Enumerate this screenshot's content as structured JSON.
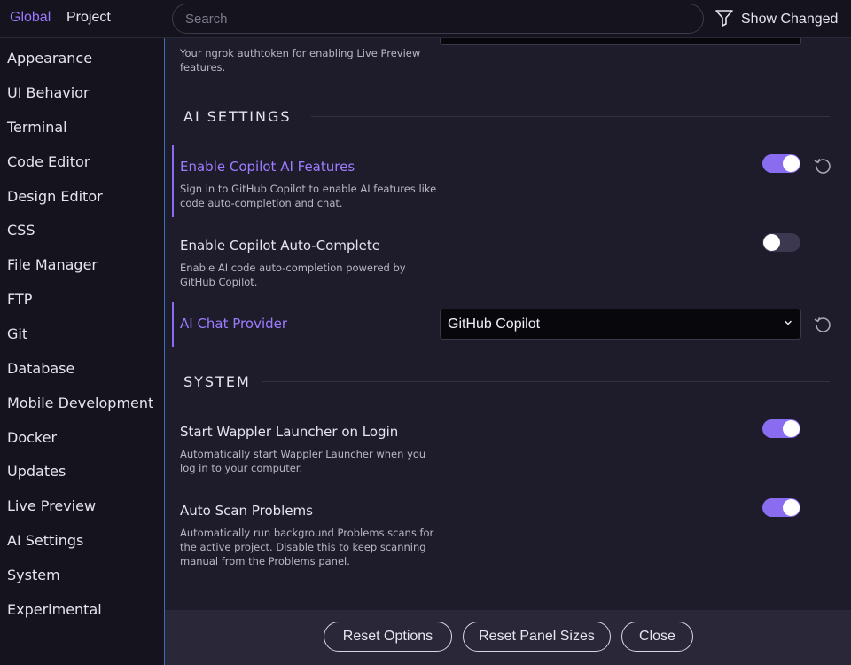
{
  "header": {
    "tabs": [
      {
        "label": "Global",
        "active": true
      },
      {
        "label": "Project",
        "active": false
      }
    ],
    "search": {
      "placeholder": "Search",
      "value": ""
    },
    "show_changed_label": "Show Changed"
  },
  "sidebar": {
    "items": [
      {
        "label": "Appearance"
      },
      {
        "label": "UI Behavior"
      },
      {
        "label": "Terminal"
      },
      {
        "label": "Code Editor"
      },
      {
        "label": "Design Editor"
      },
      {
        "label": "CSS"
      },
      {
        "label": "File Manager"
      },
      {
        "label": "FTP"
      },
      {
        "label": "Git"
      },
      {
        "label": "Database"
      },
      {
        "label": "Mobile Development"
      },
      {
        "label": "Docker"
      },
      {
        "label": "Updates"
      },
      {
        "label": "Live Preview"
      },
      {
        "label": "AI Settings"
      },
      {
        "label": "System"
      },
      {
        "label": "Experimental"
      }
    ]
  },
  "main": {
    "ngrok_description": "Your ngrok authtoken for enabling Live Preview features.",
    "ai_section_title": "AI SETTINGS",
    "copilot": {
      "title": "Enable Copilot AI Features",
      "description": "Sign in to GitHub Copilot to enable AI features like code auto-completion and chat.",
      "enabled": true
    },
    "autocomplete": {
      "title": "Enable Copilot Auto-Complete",
      "description": "Enable AI code auto-completion powered by GitHub Copilot.",
      "enabled": false
    },
    "chat_provider": {
      "title": "AI Chat Provider",
      "selected": "GitHub Copilot"
    },
    "system_section_title": "SYSTEM",
    "launcher": {
      "title": "Start Wappler Launcher on Login",
      "description": "Automatically start Wappler Launcher when you log in to your computer.",
      "enabled": true
    },
    "scan": {
      "title": "Auto Scan Problems",
      "description": "Automatically run background Problems scans for the active project. Disable this to keep scanning manual from the Problems panel.",
      "enabled": true
    }
  },
  "footer": {
    "reset_options": "Reset Options",
    "reset_panel_sizes": "Reset Panel Sizes",
    "close": "Close"
  },
  "colors": {
    "accent": "#8a6cf0",
    "background": "#1e1c2b",
    "sidebar": "#15141e"
  }
}
